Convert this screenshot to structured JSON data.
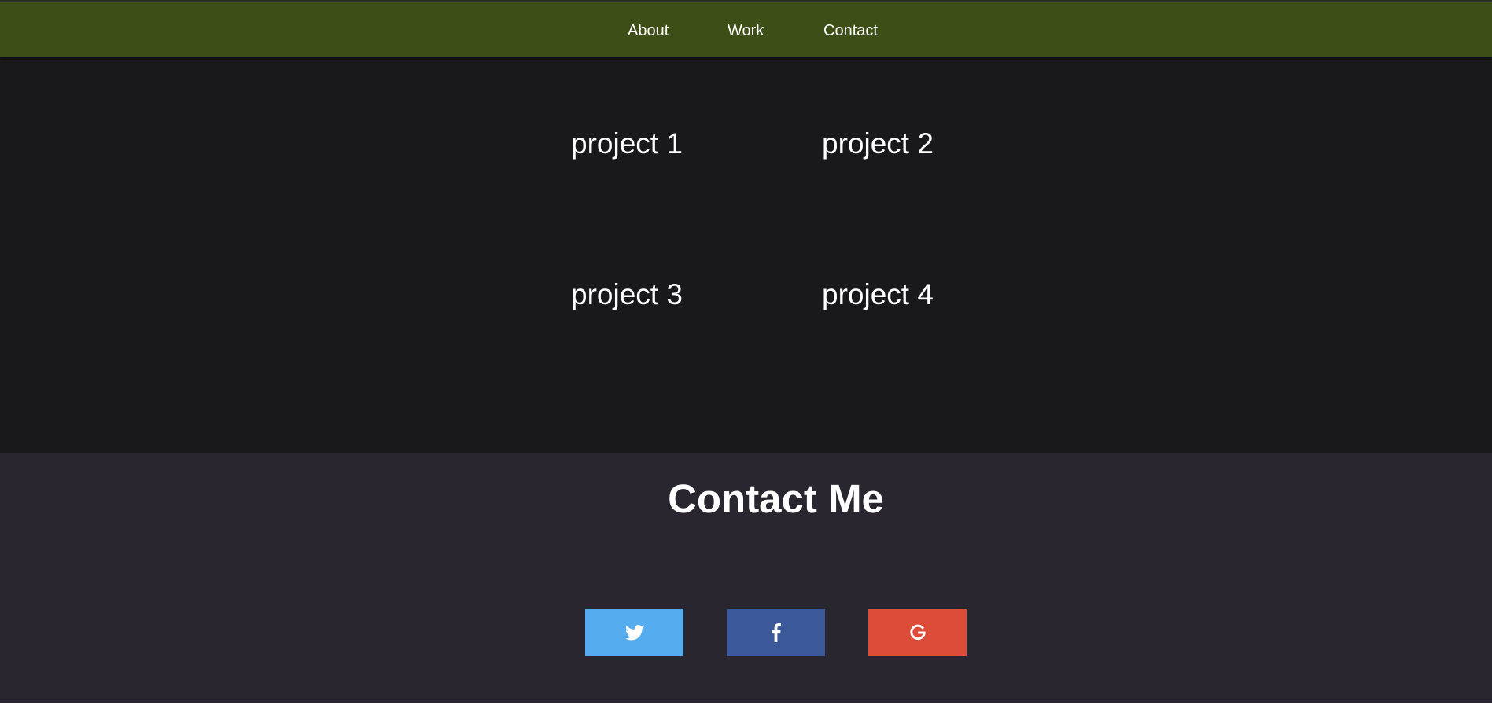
{
  "nav": {
    "items": [
      {
        "label": "About"
      },
      {
        "label": "Work"
      },
      {
        "label": "Contact"
      }
    ]
  },
  "work": {
    "projects": [
      {
        "label": "project 1"
      },
      {
        "label": "project 2"
      },
      {
        "label": "project 3"
      },
      {
        "label": "project 4"
      }
    ]
  },
  "contact": {
    "title": "Contact Me",
    "socials": [
      {
        "icon": "twitter-icon",
        "color": "#55acee"
      },
      {
        "icon": "facebook-icon",
        "color": "#3b5998"
      },
      {
        "icon": "google-icon",
        "color": "#dd4b39"
      }
    ]
  },
  "colors": {
    "nav_background": "#3d4f17",
    "work_background": "#19181a",
    "contact_background": "#2a2630",
    "text": "#ffffff"
  }
}
